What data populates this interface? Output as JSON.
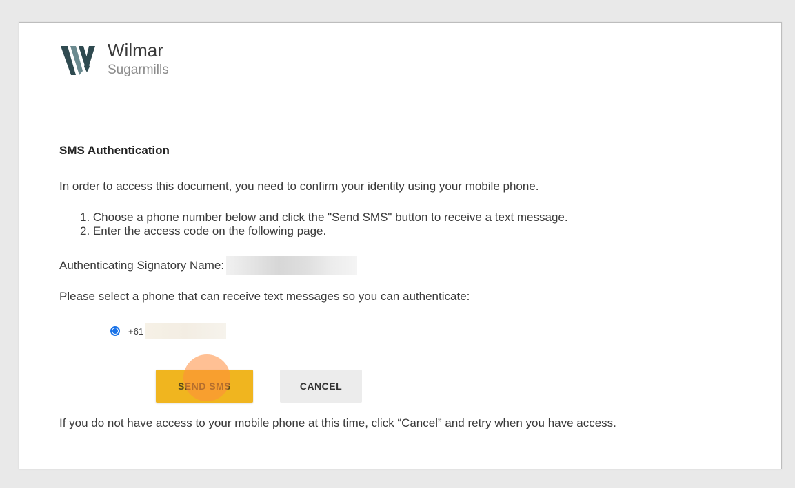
{
  "brand": {
    "name": "Wilmar",
    "subtitle": "Sugarmills",
    "logo_color": "#2f4a50"
  },
  "auth": {
    "heading": "SMS Authentication",
    "intro": "In order to access this document, you need to confirm your identity using your mobile phone.",
    "steps": [
      "1. Choose a phone number below and click the \"Send SMS\" button to receive a text message.",
      "2. Enter the access code on the following page."
    ],
    "signatory_label": "Authenticating Signatory Name:",
    "select_prompt": "Please select a phone that can receive text messages so you can authenticate:",
    "phone_prefix": "+61",
    "phone_selected": true,
    "send_label": "SEND SMS",
    "cancel_label": "CANCEL",
    "footer_note": "If you do not have access to your mobile phone at this time, click “Cancel” and retry when you have access."
  },
  "colors": {
    "primary_button": "#f0b51f",
    "secondary_button": "#ececec",
    "radio": "#1a73e8"
  }
}
